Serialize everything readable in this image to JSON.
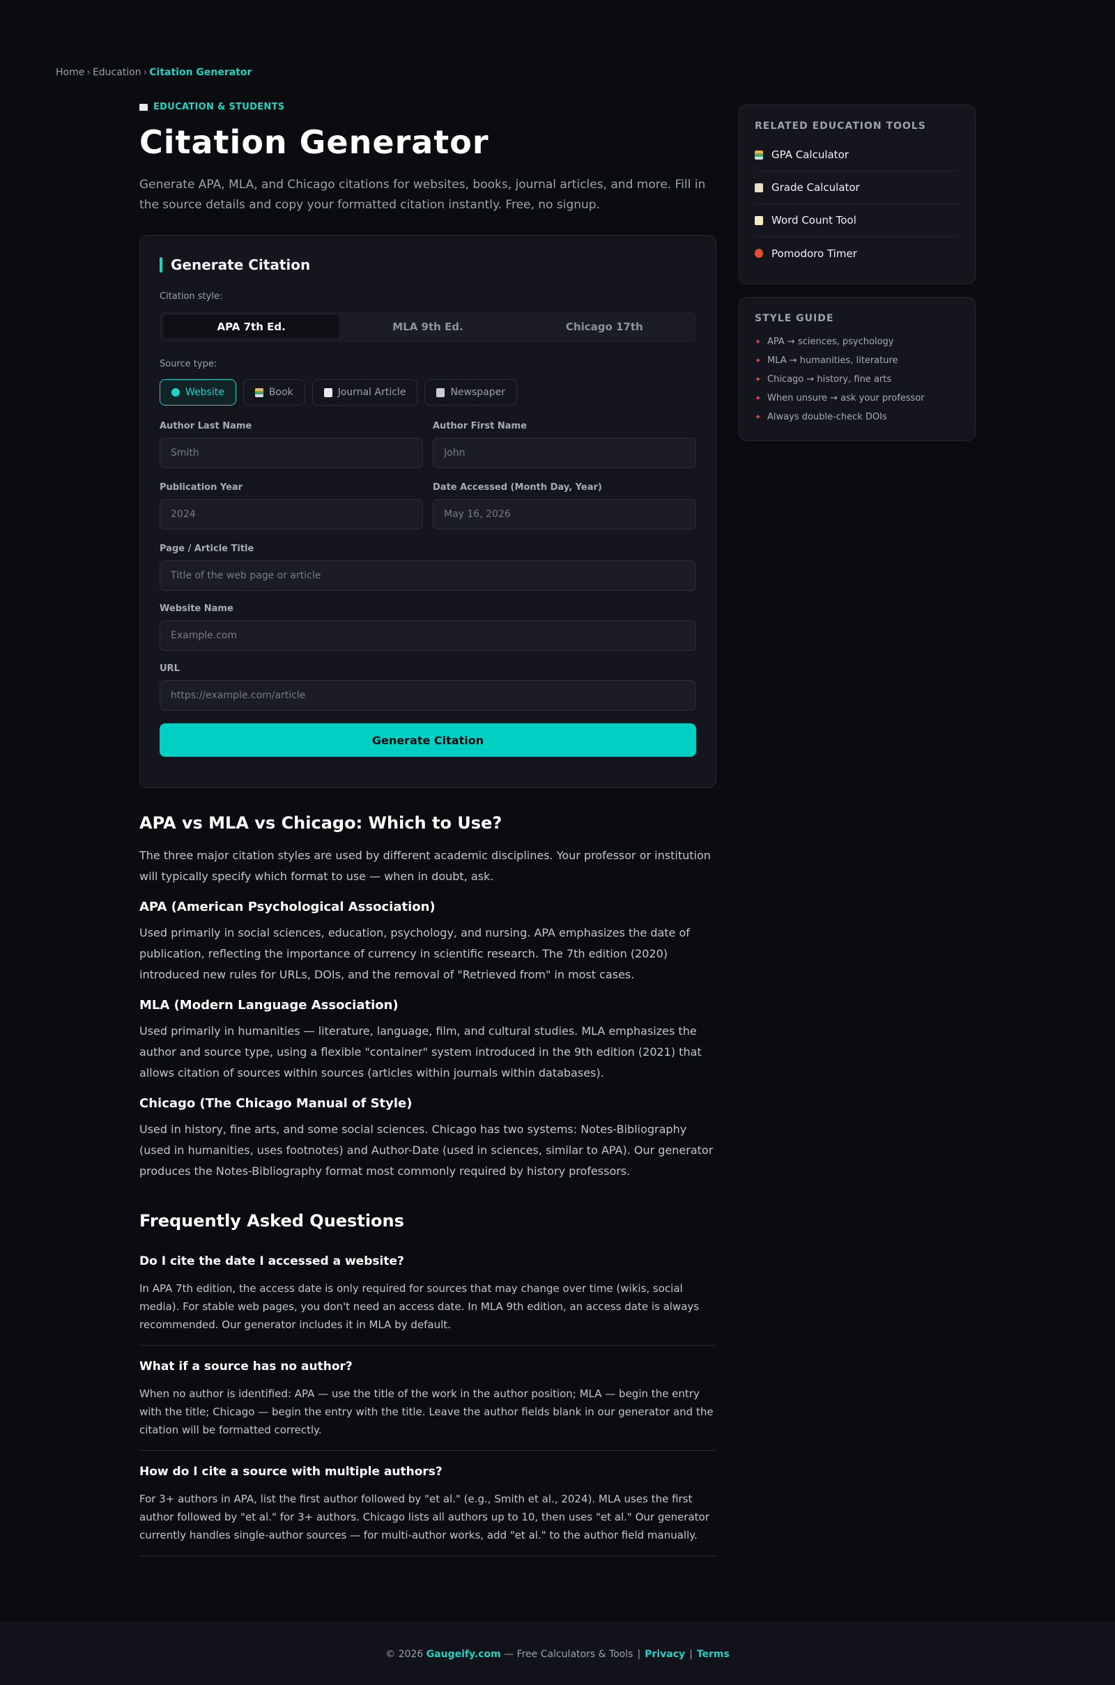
{
  "breadcrumb": {
    "home": "Home",
    "section": "Education",
    "current": "Citation Generator",
    "separator": "›"
  },
  "header": {
    "category": "EDUCATION & STUDENTS",
    "title": "Citation Generator",
    "subtitle": "Generate APA, MLA, and Chicago citations for websites, books, journal articles, and more. Fill in the source details and copy your formatted citation instantly. Free, no signup."
  },
  "form": {
    "title": "Generate Citation",
    "style_label": "Citation style:",
    "styles": [
      "APA 7th Ed.",
      "MLA 9th Ed.",
      "Chicago 17th"
    ],
    "active_style": "APA 7th Ed.",
    "source_label": "Source type:",
    "sources": [
      "Website",
      "Book",
      "Journal Article",
      "Newspaper"
    ],
    "active_source": "Website",
    "fields": {
      "author_last": {
        "label": "Author Last Name",
        "placeholder": "Smith"
      },
      "author_first": {
        "label": "Author First Name",
        "placeholder": "John"
      },
      "year": {
        "label": "Publication Year",
        "placeholder": "2024"
      },
      "accessed": {
        "label": "Date Accessed (Month Day, Year)",
        "placeholder": "May 16, 2026"
      },
      "title": {
        "label": "Page / Article Title",
        "placeholder": "Title of the web page or article"
      },
      "website": {
        "label": "Website Name",
        "placeholder": "Example.com"
      },
      "url": {
        "label": "URL",
        "placeholder": "https://example.com/article"
      }
    },
    "submit_label": "Generate Citation"
  },
  "article": {
    "heading": "APA vs MLA vs Chicago: Which to Use?",
    "intro": "The three major citation styles are used by different academic disciplines. Your professor or institution will typically specify which format to use — when in doubt, ask.",
    "sections": [
      {
        "title": "APA (American Psychological Association)",
        "body": "Used primarily in social sciences, education, psychology, and nursing. APA emphasizes the date of publication, reflecting the importance of currency in scientific research. The 7th edition (2020) introduced new rules for URLs, DOIs, and the removal of \"Retrieved from\" in most cases."
      },
      {
        "title": "MLA (Modern Language Association)",
        "body": "Used primarily in humanities — literature, language, film, and cultural studies. MLA emphasizes the author and source type, using a flexible \"container\" system introduced in the 9th edition (2021) that allows citation of sources within sources (articles within journals within databases)."
      },
      {
        "title": "Chicago (The Chicago Manual of Style)",
        "body": "Used in history, fine arts, and some social sciences. Chicago has two systems: Notes-Bibliography (used in humanities, uses footnotes) and Author-Date (used in sciences, similar to APA). Our generator produces the Notes-Bibliography format most commonly required by history professors."
      }
    ]
  },
  "faq": {
    "heading": "Frequently Asked Questions",
    "items": [
      {
        "q": "Do I cite the date I accessed a website?",
        "a": "In APA 7th edition, the access date is only required for sources that may change over time (wikis, social media). For stable web pages, you don't need an access date. In MLA 9th edition, an access date is always recommended. Our generator includes it in MLA by default."
      },
      {
        "q": "What if a source has no author?",
        "a": "When no author is identified: APA — use the title of the work in the author position; MLA — begin the entry with the title; Chicago — begin the entry with the title. Leave the author fields blank in our generator and the citation will be formatted correctly."
      },
      {
        "q": "How do I cite a source with multiple authors?",
        "a": "For 3+ authors in APA, list the first author followed by \"et al.\" (e.g., Smith et al., 2024). MLA uses the first author followed by \"et al.\" for 3+ authors. Chicago lists all authors up to 10, then uses \"et al.\" Our generator currently handles single-author sources — for multi-author works, add \"et al.\" to the author field manually."
      }
    ]
  },
  "sidebar": {
    "related_title": "RELATED EDUCATION TOOLS",
    "tools": [
      "GPA Calculator",
      "Grade Calculator",
      "Word Count Tool",
      "Pomodoro Timer"
    ],
    "guide_title": "STYLE GUIDE",
    "guide": [
      "APA → sciences, psychology",
      "MLA → humanities, literature",
      "Chicago → history, fine arts",
      "When unsure → ask your professor",
      "Always double-check DOIs"
    ]
  },
  "footer": {
    "copyright": "© 2026",
    "site": "Gaugeify.com",
    "tagline": "— Free Calculators & Tools",
    "divider": "|",
    "privacy": "Privacy",
    "terms": "Terms"
  },
  "colors": {
    "accent": "#22d3c5",
    "button": "#00cfc4",
    "background": "#0b0c10",
    "card": "#14151d"
  }
}
